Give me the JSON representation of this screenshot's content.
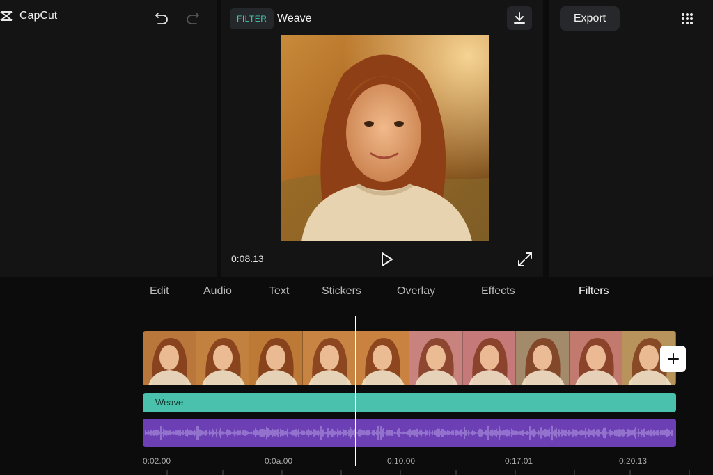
{
  "app": {
    "name": "CapCut"
  },
  "toolbar": {
    "undo_icon": "undo-icon",
    "redo_icon": "redo-icon"
  },
  "preview": {
    "filter_badge": "FILTER",
    "filter_name": "Weave",
    "current_time": "0:08.13"
  },
  "actions": {
    "export_label": "Export"
  },
  "tabs": [
    {
      "label": "Edit",
      "active": false
    },
    {
      "label": "Audio",
      "active": false
    },
    {
      "label": "Text",
      "active": false
    },
    {
      "label": "Stickers",
      "active": false
    },
    {
      "label": "Overlay",
      "active": false
    },
    {
      "label": "Effects",
      "active": false
    },
    {
      "label": "Filters",
      "active": true
    }
  ],
  "timeline": {
    "filter_track_label": "Weave",
    "ruler": [
      "0:02.00",
      "0:0a.00",
      "0:10.00",
      "0:17.01",
      "0:20.13"
    ]
  },
  "colors": {
    "accent_teal": "#49c1ac",
    "audio_purple": "#6d3fb4",
    "badge_text": "#45c9b4"
  }
}
